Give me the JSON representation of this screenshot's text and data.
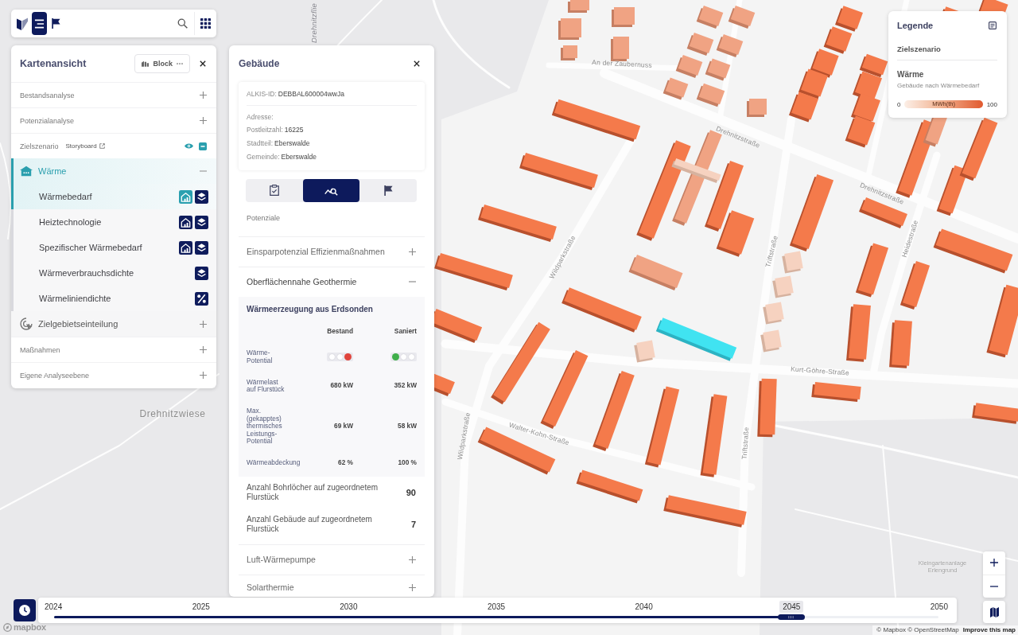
{
  "toolbar": {
    "buttons": [
      {
        "selected": false
      },
      {
        "selected": true
      },
      {
        "selected": false
      }
    ]
  },
  "layer_panel": {
    "title": "Kartenansicht",
    "view_button": "Block",
    "sections": [
      {
        "label": "Bestandsanalyse",
        "expanded": false
      },
      {
        "label": "Potenzialanalyse",
        "expanded": false
      },
      {
        "label": "Zielszenario",
        "link": "Storyboard",
        "visible": true,
        "expanded": true,
        "groups": [
          {
            "label": "Wärme",
            "expanded": true,
            "items": [
              {
                "label": "Wärmebedarf",
                "kind": "building",
                "selected": true
              },
              {
                "label": "Heiztechnologie",
                "kind": "building",
                "selected": false
              },
              {
                "label": "Spezifischer Wärmebedarf",
                "kind": "building",
                "selected": false
              },
              {
                "label": "Wärmeverbrauchsdichte",
                "kind": "area",
                "selected": false
              },
              {
                "label": "Wärmeliniendichte",
                "kind": "line",
                "selected": false
              }
            ]
          },
          {
            "label": "Zielgebietseinteilung",
            "expanded": false
          }
        ]
      },
      {
        "label": "Maßnahmen",
        "expanded": false
      },
      {
        "label": "Eigene Analyseebene",
        "expanded": false
      }
    ]
  },
  "building_panel": {
    "title": "Gebäude",
    "info": [
      {
        "label": "ALKIS-ID:",
        "value": "DEBBAL600004wwJa"
      },
      {
        "label": "Adresse:"
      },
      {
        "label": "Postleitzahl:",
        "value": "16225"
      },
      {
        "label": "Stadtteil:",
        "value": "Eberswalde"
      },
      {
        "label": "Gemeinde:",
        "value": "Eberswalde"
      }
    ],
    "tabs": [
      {
        "selected": false
      },
      {
        "selected": true
      },
      {
        "selected": false
      }
    ],
    "caption": "Potenziale",
    "sections": [
      {
        "label": "Einsparpotenzial Effizienmaßnahmen",
        "expanded": false
      },
      {
        "label": "Oberflächennahe Geothermie",
        "expanded": true,
        "table": {
          "title": "Wärmeerzeugung aus Erdsonden",
          "columns": [
            "Bestand",
            "Saniert"
          ],
          "rows": [
            {
              "label": "Wärme-\nPotential",
              "kind": "lights",
              "cells": [
                {
                  "lights": [
                    {
                      "on": false
                    },
                    {
                      "on": false
                    },
                    {
                      "on": true,
                      "color": "#e0443c"
                    }
                  ]
                },
                {
                  "lights": [
                    {
                      "on": true,
                      "color": "#3fae4a"
                    },
                    {
                      "on": false
                    },
                    {
                      "on": false
                    }
                  ]
                }
              ]
            },
            {
              "label": "Wärmelast\nauf Flurstück",
              "kind": "text",
              "cells": [
                "680 kW",
                "352 kW"
              ]
            },
            {
              "label": "Max.\n(gekapptes)\nthermisches\nLeistungs-\nPotential",
              "kind": "text",
              "cells": [
                "69 kW",
                "58 kW"
              ]
            },
            {
              "label": "Wärmeabdeckung",
              "kind": "text",
              "cells": [
                "62 %",
                "100 %"
              ]
            }
          ]
        },
        "metrics": [
          {
            "label": "Anzahl Bohrlöcher auf zugeordnetem Flurstück",
            "value": "90"
          },
          {
            "label": "Anzahl Gebäude auf zugeordnetem Flurstück",
            "value": "7"
          }
        ]
      },
      {
        "label": "Luft-Wärmepumpe",
        "expanded": false
      },
      {
        "label": "Solarthermie",
        "expanded": false
      }
    ]
  },
  "legend": {
    "title": "Legende",
    "scenario": "Zielszenario",
    "heading": "Wärme",
    "subtitle": "Gebäude nach Wärmebedarf",
    "scale": {
      "min": "0",
      "unit": "MWh(th)",
      "max": "100"
    }
  },
  "timeline": {
    "years": [
      {
        "label": "2024",
        "selected": false
      },
      {
        "label": "2025",
        "selected": false
      },
      {
        "label": "2030",
        "selected": false
      },
      {
        "label": "2035",
        "selected": false
      },
      {
        "label": "2040",
        "selected": false
      },
      {
        "label": "2045",
        "selected": true
      },
      {
        "label": "2050",
        "selected": false
      }
    ],
    "level": 0.8333
  },
  "map": {
    "labels": [
      {
        "text": "An der Zaubernuss",
        "kind": "street"
      },
      {
        "text": "Drehnitzstraße",
        "kind": "street"
      },
      {
        "text": "Drehnitzstraße",
        "kind": "street"
      },
      {
        "text": "Wildparkstraße",
        "kind": "street"
      },
      {
        "text": "Triftstraße",
        "kind": "street"
      },
      {
        "text": "Heidestraße",
        "kind": "street"
      },
      {
        "text": "Kurt-Göhre-Straße",
        "kind": "street"
      },
      {
        "text": "Walter-Kohn-Straße",
        "kind": "street"
      },
      {
        "text": "Wildparkstraße",
        "kind": "street"
      },
      {
        "text": "Triftstraße",
        "kind": "street"
      },
      {
        "text": "Drehnitzwiese",
        "kind": "area"
      },
      {
        "text": "Kleingartenanlage Erlengrund",
        "kind": "place"
      },
      {
        "text": "Drehnitzflie",
        "kind": "water"
      }
    ],
    "logo": "mapbox",
    "attribution": "© Mapbox © OpenStreetMap",
    "improve_link": "Improve this map"
  }
}
